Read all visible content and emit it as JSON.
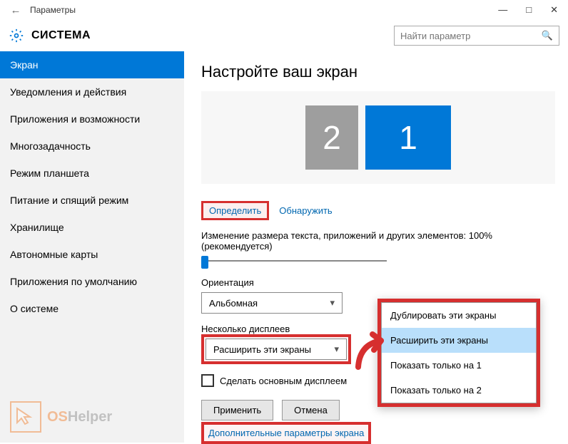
{
  "titlebar": {
    "title": "Параметры"
  },
  "header": {
    "title": "СИСТЕМА",
    "search_placeholder": "Найти параметр"
  },
  "sidebar": {
    "items": [
      {
        "label": "Экран",
        "selected": true
      },
      {
        "label": "Уведомления и действия"
      },
      {
        "label": "Приложения и возможности"
      },
      {
        "label": "Многозадачность"
      },
      {
        "label": "Режим планшета"
      },
      {
        "label": "Питание и спящий режим"
      },
      {
        "label": "Хранилище"
      },
      {
        "label": "Автономные карты"
      },
      {
        "label": "Приложения по умолчанию"
      },
      {
        "label": "О системе"
      }
    ]
  },
  "main": {
    "page_title": "Настройте ваш экран",
    "monitors": {
      "m1": "1",
      "m2": "2"
    },
    "identify_link": "Определить",
    "detect_link": "Обнаружить",
    "scale_label": "Изменение размера текста, приложений и других элементов: 100% (рекомендуется)",
    "orientation_label": "Ориентация",
    "orientation_value": "Альбомная",
    "multiple_label": "Несколько дисплеев",
    "multiple_value": "Расширить эти экраны",
    "make_primary": "Сделать основным дисплеем",
    "apply_btn": "Применить",
    "cancel_btn": "Отмена",
    "advanced_link": "Дополнительные параметры экрана"
  },
  "popup": {
    "items": [
      {
        "label": "Дублировать эти экраны"
      },
      {
        "label": "Расширить эти экраны",
        "selected": true
      },
      {
        "label": "Показать только на 1"
      },
      {
        "label": "Показать только на 2"
      }
    ]
  },
  "watermark": {
    "os": "OS",
    "helper": "Helper"
  }
}
